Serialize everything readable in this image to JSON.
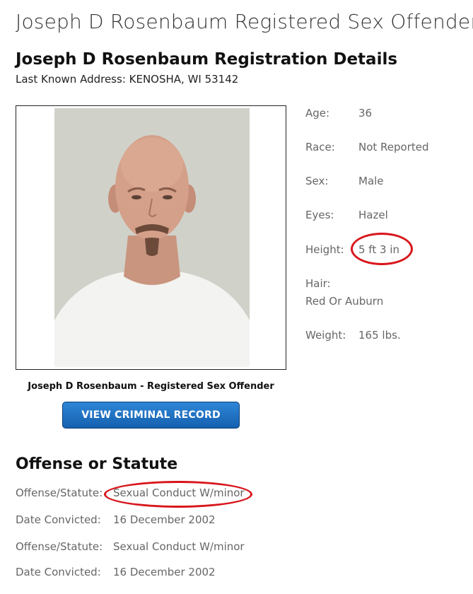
{
  "page": {
    "title": "Joseph D Rosenbaum Registered Sex Offender",
    "registration_heading": "Joseph D Rosenbaum Registration Details",
    "address_line": "Last Known Address: KENOSHA, WI 53142"
  },
  "profile": {
    "caption": "Joseph D Rosenbaum - Registered Sex Offender",
    "button_label": "VIEW CRIMINAL RECORD"
  },
  "details": {
    "age_label": "Age:",
    "age_value": "36",
    "race_label": "Race:",
    "race_value": "Not Reported",
    "sex_label": "Sex:",
    "sex_value": "Male",
    "eyes_label": "Eyes:",
    "eyes_value": "Hazel",
    "height_label": "Height:",
    "height_value": "5 ft 3 in",
    "hair_label": "Hair:",
    "hair_value": "Red Or Auburn",
    "weight_label": "Weight:",
    "weight_value": "165 lbs."
  },
  "offenses": {
    "heading": "Offense or Statute",
    "rows": [
      {
        "label": "Offense/Statute:",
        "value": "Sexual Conduct W/minor"
      },
      {
        "label": "Date Convicted:",
        "value": "16 December 2002"
      },
      {
        "label": "Offense/Statute:",
        "value": "Sexual Conduct W/minor"
      },
      {
        "label": "Date Convicted:",
        "value": "16 December 2002"
      }
    ]
  },
  "colors": {
    "button": "#1f6fc2",
    "annotation_circle": "#d8151b"
  }
}
